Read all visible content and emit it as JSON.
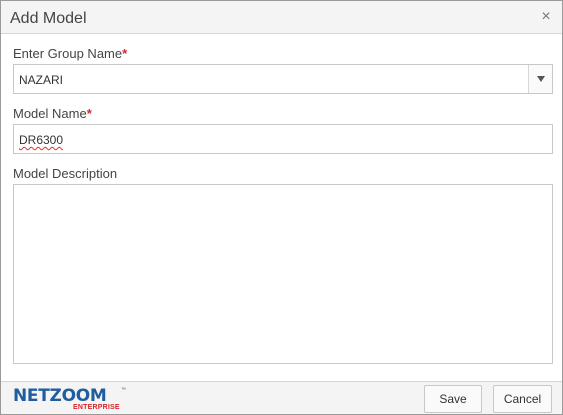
{
  "dialog": {
    "title": "Add Model",
    "close_glyph": "×"
  },
  "group_field": {
    "label": "Enter Group Name",
    "required_mark": "*",
    "value": "NAZARI",
    "arrow_icon": "caret-down-icon"
  },
  "model_name_field": {
    "label": "Model Name",
    "required_mark": "*",
    "value": "DR6300"
  },
  "description_field": {
    "label": "Model Description",
    "value": ""
  },
  "footer": {
    "logo_main": "NETZOOM",
    "logo_sub": "ENTERPRISE",
    "logo_tm": "™",
    "save_label": "Save",
    "cancel_label": "Cancel"
  },
  "colors": {
    "required": "#d9262b",
    "logo_blue": "#1f5d9e",
    "logo_red": "#d9262b",
    "header_bg": "#f4f4f4"
  }
}
